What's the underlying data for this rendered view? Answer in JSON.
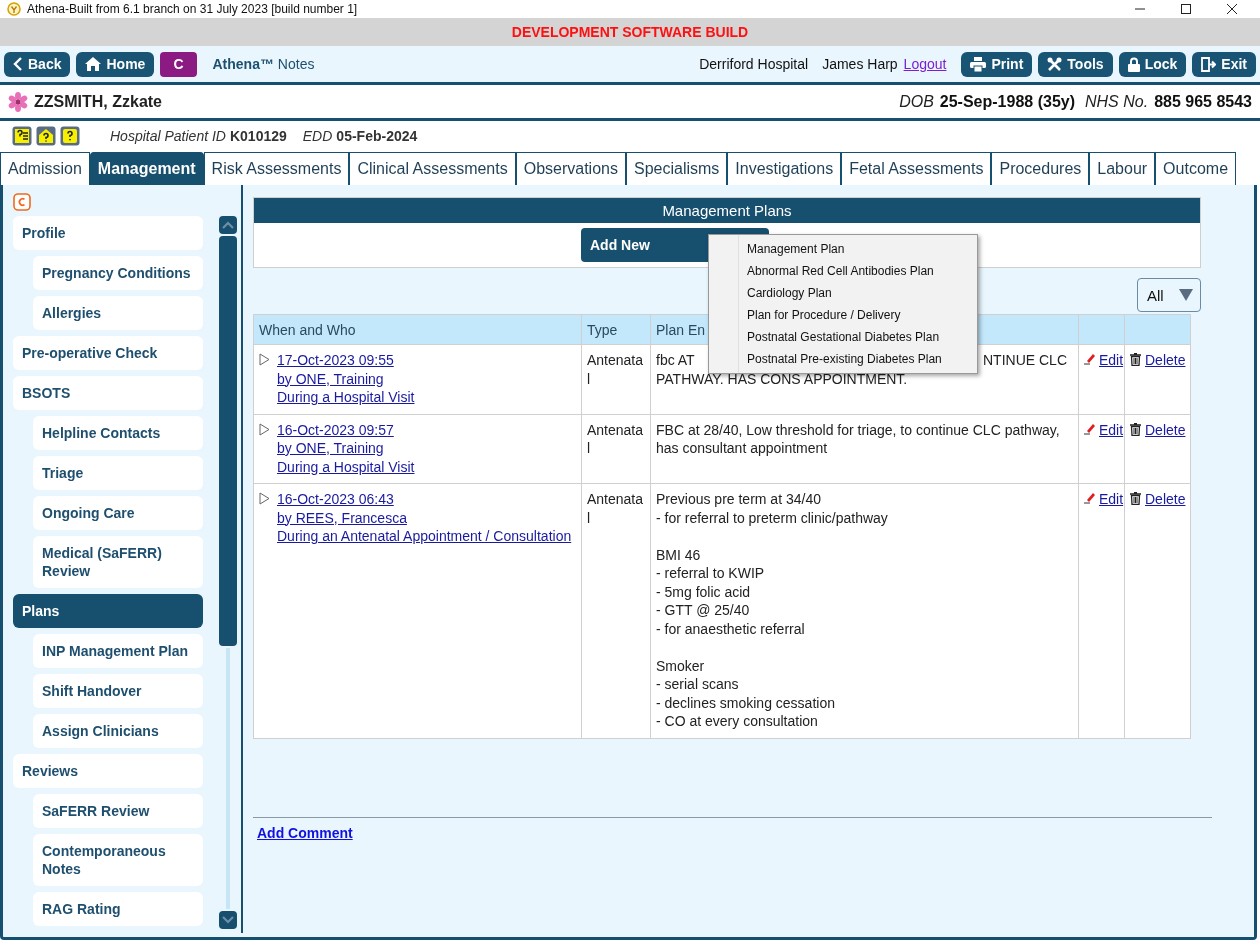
{
  "window": {
    "title": "Athena-Built from 6.1 branch on 31 July 2023 [build number 1]"
  },
  "banner": "DEVELOPMENT SOFTWARE BUILD",
  "toolbar": {
    "left_buttons": [
      {
        "label": "Back",
        "kind": "nav"
      },
      {
        "label": "Home",
        "kind": "nav"
      },
      {
        "label": "C",
        "kind": "context"
      }
    ],
    "app_name": "**Athena™** Notes",
    "hospital": "Derriford Hospital",
    "user": "James Harp",
    "logout": "Logout",
    "right_buttons": [
      {
        "label": "Print"
      },
      {
        "label": "Tools"
      },
      {
        "label": "Lock"
      },
      {
        "label": "Exit"
      }
    ]
  },
  "patient": {
    "name": "ZZSMITH, Zzkate",
    "dob_label": "DOB",
    "dob": "25-Sep-1988 (35y)",
    "nhs_label": "NHS No.",
    "nhs": "885 965 8543"
  },
  "details": {
    "hospital_id_label": "Hospital Patient ID",
    "hospital_id": "K010129",
    "edd_label": "EDD",
    "edd": "05-Feb-2024"
  },
  "tabs": [
    {
      "label": "Admission",
      "selected": false
    },
    {
      "label": "Management",
      "selected": true
    },
    {
      "label": "Risk Assessments",
      "selected": false
    },
    {
      "label": "Clinical Assessments",
      "selected": false
    },
    {
      "label": "Observations",
      "selected": false
    },
    {
      "label": "Specialisms",
      "selected": false
    },
    {
      "label": "Investigations",
      "selected": false
    },
    {
      "label": "Fetal Assessments",
      "selected": false
    },
    {
      "label": "Procedures",
      "selected": false
    },
    {
      "label": "Labour",
      "selected": false
    },
    {
      "label": "Outcome",
      "selected": false
    }
  ],
  "sidebar": {
    "items": [
      {
        "label": "Profile",
        "selected": false,
        "children": [
          {
            "label": "Pregnancy Conditions",
            "selected": false
          },
          {
            "label": "Allergies",
            "selected": false
          }
        ]
      },
      {
        "label": "Pre-operative Check",
        "selected": false
      },
      {
        "label": "BSOTS",
        "selected": false,
        "children": [
          {
            "label": "Helpline Contacts",
            "selected": false
          },
          {
            "label": "Triage",
            "selected": false
          },
          {
            "label": "Ongoing Care",
            "selected": false
          },
          {
            "label": "Medical (SaFERR) Review",
            "selected": false
          }
        ]
      },
      {
        "label": "Plans",
        "selected": true,
        "children": [
          {
            "label": "INP Management Plan",
            "selected": false
          },
          {
            "label": "Shift Handover",
            "selected": false
          },
          {
            "label": "Assign Clinicians",
            "selected": false
          }
        ]
      },
      {
        "label": "Reviews",
        "selected": false,
        "children": [
          {
            "label": "SaFERR Review",
            "selected": false
          },
          {
            "label": "Contemporaneous Notes",
            "selected": false
          },
          {
            "label": "RAG Rating",
            "selected": false
          }
        ]
      }
    ]
  },
  "content": {
    "title": "Management Plans",
    "add_button": "Add New",
    "menu": [
      "Management Plan",
      "Abnormal Red Cell Antibodies Plan",
      "Cardiology Plan",
      "Plan for Procedure / Delivery",
      "Postnatal Gestational Diabetes Plan",
      "Postnatal Pre-existing Diabetes Plan"
    ],
    "filter": "All",
    "table": {
      "columns": [
        "When and Who",
        "Type",
        "Plan En"
      ],
      "rows": [
        {
          "when": "17-Oct-2023 09:55",
          "by": "by ONE, Training",
          "context": "During a Hospital Visit",
          "type": "Antenatal",
          "plan": [
            [
              "fbc AT",
              "PATHWAY. HAS CONS APPOINTMENT."
            ]
          ],
          "plan_tail": "NTINUE CLC",
          "edit": "Edit",
          "delete": "Delete"
        },
        {
          "when": "16-Oct-2023 09:57",
          "by": "by ONE, Training",
          "context": "During a Hospital Visit",
          "type": "Antenatal",
          "plan": [
            [
              "FBC at 28/40, Low threshold for triage, to continue CLC pathway,",
              "has consultant appointment"
            ]
          ],
          "edit": "Edit",
          "delete": "Delete"
        },
        {
          "when": "16-Oct-2023 06:43",
          "by": "by REES, Francesca",
          "context": "During an Antenatal Appointment / Consultation",
          "type": "Antenatal",
          "plan": [
            [
              "Previous pre term at 34/40",
              "- for referral to preterm clinic/pathway"
            ],
            [
              "BMI 46",
              "- referral to KWIP",
              "- 5mg folic acid",
              "- GTT @ 25/40",
              "- for anaesthetic referral"
            ],
            [
              "Smoker",
              "- serial scans",
              "- declines smoking cessation",
              "- CO at every consultation"
            ]
          ],
          "edit": "Edit",
          "delete": "Delete"
        }
      ]
    },
    "comment_link": "Add Comment"
  }
}
